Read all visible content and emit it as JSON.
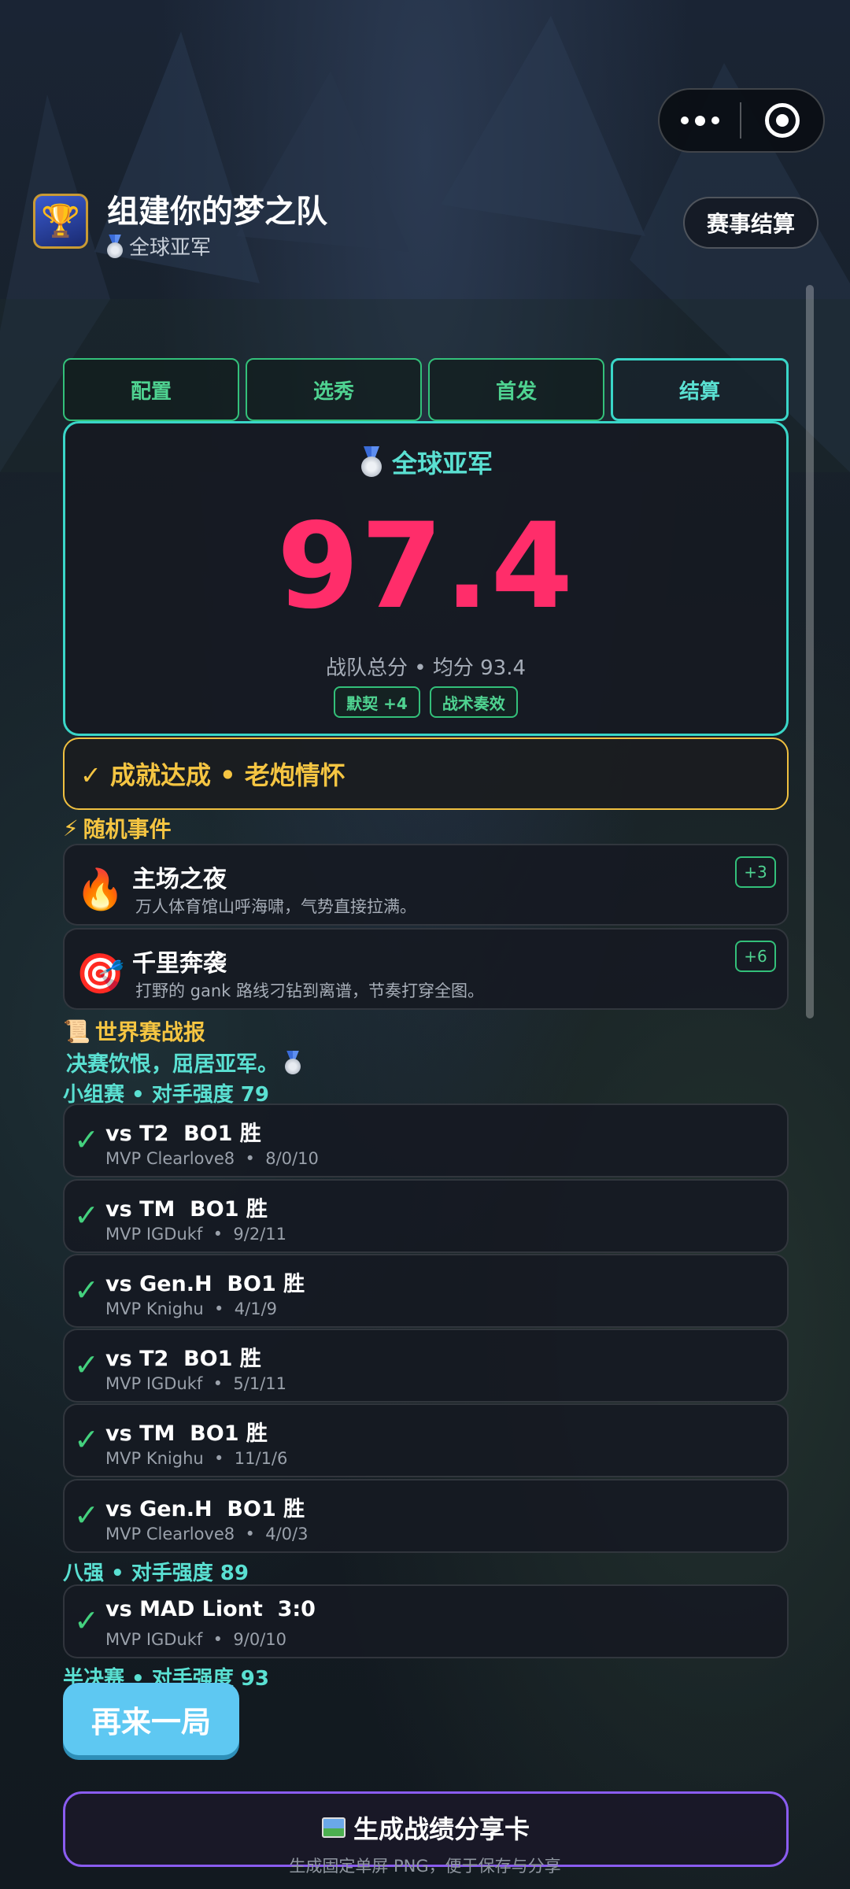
{
  "header": {
    "title": "组建你的梦之队",
    "subtitle": "全球亚军",
    "settle_button": "赛事结算"
  },
  "tabs": [
    {
      "label": "配置",
      "active": false
    },
    {
      "label": "选秀",
      "active": false
    },
    {
      "label": "首发",
      "active": false
    },
    {
      "label": "结算",
      "active": true
    }
  ],
  "score": {
    "rank": "全球亚军",
    "value": "97.4",
    "meta": "战队总分 • 均分 93.4",
    "chips": [
      "默契 +4",
      "战术奏效"
    ]
  },
  "achievement": "✓ 成就达成 • 老炮情怀",
  "events": {
    "heading": "随机事件",
    "items": [
      {
        "icon": "fire-icon",
        "title": "主场之夜",
        "desc": "万人体育馆山呼海啸，气势直接拉满。",
        "points": "+3"
      },
      {
        "icon": "target-icon",
        "title": "千里奔袭",
        "desc": "打野的 gank 路线刁钻到离谱，节奏打穿全图。",
        "points": "+6"
      }
    ]
  },
  "report": {
    "heading": "世界赛战报",
    "summary": "决赛饮恨，屈居亚军。",
    "stages": [
      {
        "title": "小组赛 • 对手强度 79"
      },
      {
        "title": "八强 • 对手强度 89"
      },
      {
        "title": "半决赛 • 对手强度 93"
      }
    ],
    "matches": [
      {
        "title": "vs T2  BO1 胜",
        "mvp": "MVP Clearlove8  •  8/0/10"
      },
      {
        "title": "vs TM  BO1 胜",
        "mvp": "MVP IGDukf  •  9/2/11"
      },
      {
        "title": "vs Gen.H  BO1 胜",
        "mvp": "MVP Knighu  •  4/1/9"
      },
      {
        "title": "vs T2  BO1 胜",
        "mvp": "MVP IGDukf  •  5/1/11"
      },
      {
        "title": "vs TM  BO1 胜",
        "mvp": "MVP Knighu  •  11/1/6"
      },
      {
        "title": "vs Gen.H  BO1 胜",
        "mvp": "MVP Clearlove8  •  4/0/3"
      },
      {
        "title": "vs MAD Liont  3:0",
        "mvp": "MVP IGDukf  •  9/0/10"
      }
    ]
  },
  "actions": {
    "again": "再来一局",
    "share": "生成战绩分享卡",
    "share_sub": "生成固定单屏 PNG，便于保存与分享"
  },
  "colors": {
    "accent": "#3ad6c8",
    "score": "#ff2d6a",
    "success": "#44d17e",
    "gold": "#f5c542",
    "share_border": "#8a5cf0"
  }
}
